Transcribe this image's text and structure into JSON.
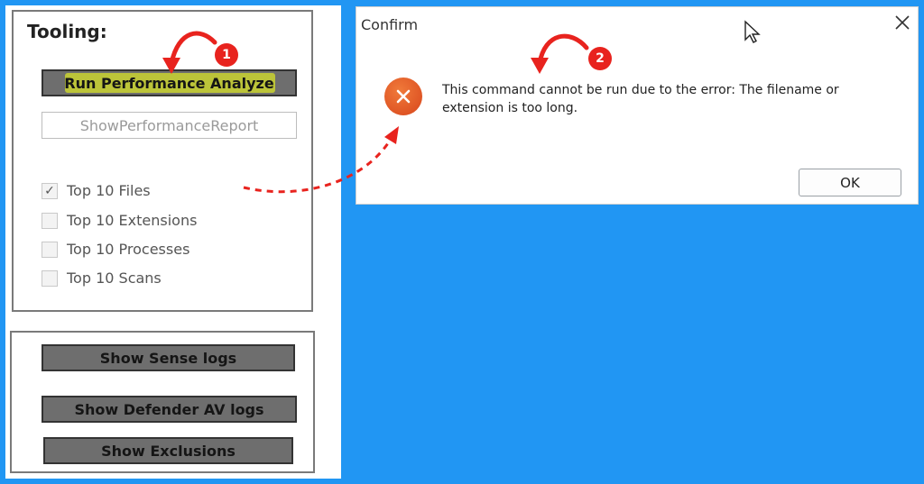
{
  "tooling": {
    "title": "Tooling:",
    "run_button_label": "Run Performance Analyze",
    "report_button_label": "ShowPerformanceReport",
    "checkboxes": [
      {
        "label": "Top 10 Files",
        "checked": true
      },
      {
        "label": "Top 10 Extensions",
        "checked": false
      },
      {
        "label": "Top 10 Processes",
        "checked": false
      },
      {
        "label": "Top 10 Scans",
        "checked": false
      }
    ]
  },
  "logs": {
    "sense_button_label": "Show Sense logs",
    "defender_button_label": "Show Defender AV logs",
    "exclusions_button_label": "Show Exclusions"
  },
  "dialog": {
    "title": "Confirm",
    "message": "This command cannot be run due to the error: The filename or extension is too long.",
    "ok_label": "OK",
    "close_icon": "close-icon",
    "error_icon": "error-icon"
  },
  "annotations": {
    "badge_1": "1",
    "badge_2": "2"
  },
  "colors": {
    "background": "#2196f3",
    "annotation_red": "#e8231e",
    "highlight_yellow": "#d7e128",
    "error_orange": "#e0521f"
  }
}
